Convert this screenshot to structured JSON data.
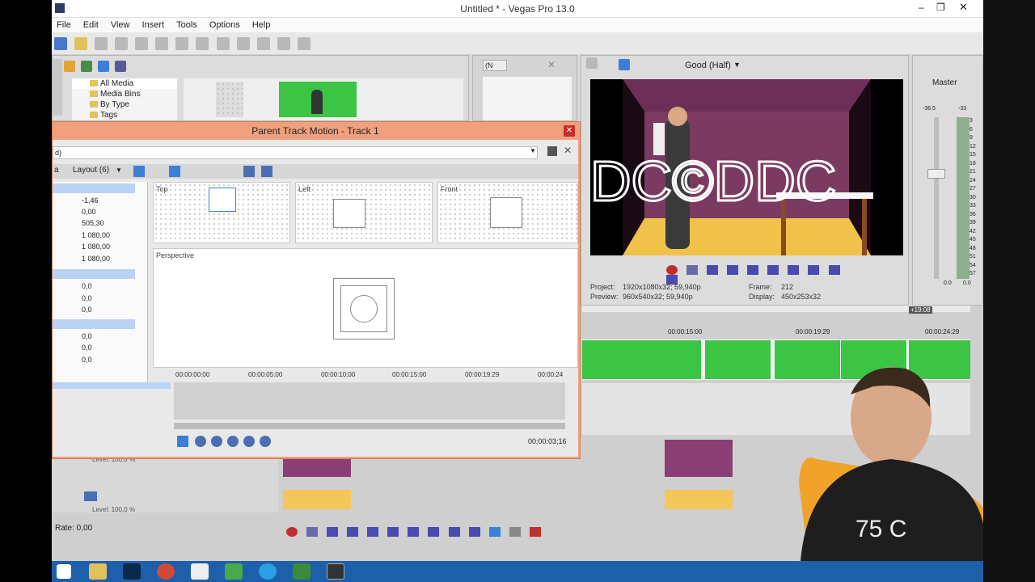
{
  "window": {
    "title": "Untitled * - Vegas Pro 13.0"
  },
  "menu": [
    "File",
    "Edit",
    "View",
    "Insert",
    "Tools",
    "Options",
    "Help"
  ],
  "explorer": {
    "items": [
      "All Media",
      "Media Bins",
      "By Type",
      "Tags"
    ]
  },
  "preview_toolbar": {
    "quality": "Good (Half)",
    "zoom_combo": "(N"
  },
  "preview_info": {
    "project_label": "Project:",
    "project_value": "1920x1080x32; 59,940p",
    "preview_label": "Preview:",
    "preview_value": "960x540x32; 59,940p",
    "frame_label": "Frame:",
    "frame_value": "212",
    "display_label": "Display:",
    "display_value": "450x253x32"
  },
  "master": {
    "label": "Master",
    "left_db": "-36.5",
    "right_db": "-33",
    "meter_bottom_left": "0.0",
    "meter_bottom_right": "0.0",
    "scale": [
      "3",
      "6",
      "9",
      "12",
      "15",
      "18",
      "21",
      "24",
      "27",
      "30",
      "33",
      "36",
      "39",
      "42",
      "45",
      "48",
      "51",
      "54",
      "57"
    ]
  },
  "timeline": {
    "badge": "+19:08",
    "markers": [
      "00:00:15:00",
      "00:00:19:29",
      "00:00:24:29"
    ],
    "tracks": [
      {
        "level": "Level: 100,0 %"
      },
      {
        "level": "Level: 100,0 %"
      }
    ],
    "rate": "Rate: 0,00"
  },
  "dialog": {
    "title": "Parent Track Motion - Track 1",
    "preset": "d)",
    "layout": "Layout (6)",
    "values_a": [
      "-1,46",
      "0,00",
      "505,30",
      "1 080,00",
      "1 080,00",
      "1 080,00"
    ],
    "values_b": [
      "0,0",
      "0,0",
      "0,0"
    ],
    "values_c": [
      "0,0",
      "0,0",
      "0,0"
    ],
    "views": {
      "top": "Top",
      "left": "Left",
      "front": "Front",
      "perspective": "Perspective"
    },
    "ruler": [
      "00:00:00:00",
      "00:00:05:00",
      "00:00:10:00",
      "00:00:15:00",
      "00:00:19:29",
      "00:00:24"
    ],
    "time": "00:00:03;16"
  }
}
